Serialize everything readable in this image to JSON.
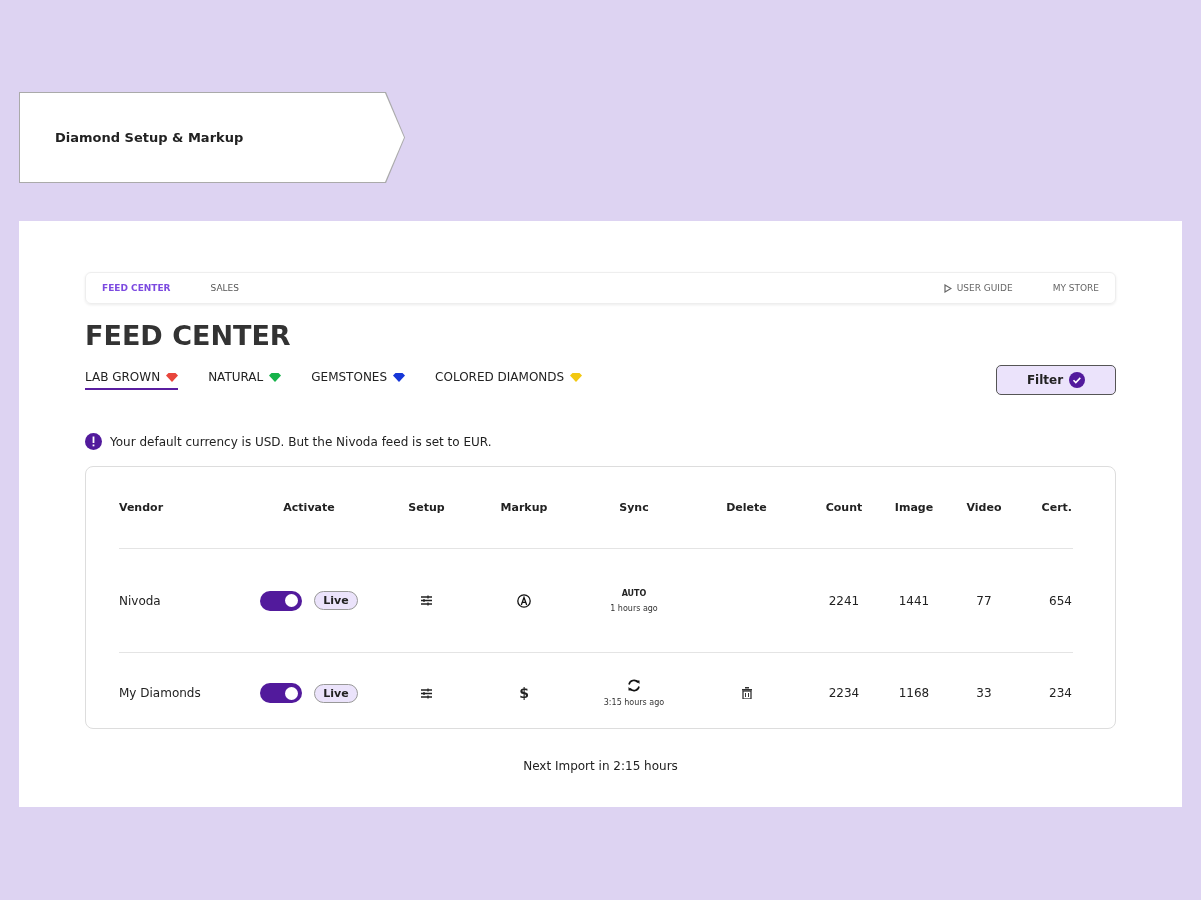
{
  "breadcrumb": {
    "label": "Diamond Setup & Markup"
  },
  "nav": {
    "tabs": [
      {
        "label": "FEED CENTER",
        "selected": true
      },
      {
        "label": "SALES",
        "selected": false
      }
    ],
    "links": [
      {
        "label": "USER GUIDE",
        "kind": "guide"
      },
      {
        "label": "MY STORE",
        "kind": "plain"
      }
    ]
  },
  "page_title": "FEED CENTER",
  "categories": [
    {
      "label": "LAB GROWN",
      "color": "#e8463c",
      "selected": true
    },
    {
      "label": "NATURAL",
      "color": "#16b34a",
      "selected": false
    },
    {
      "label": "GEMSTONES",
      "color": "#1637d8",
      "selected": false
    },
    {
      "label": "COLORED DIAMONDS",
      "color": "#f2c811",
      "selected": false
    }
  ],
  "filter_button": {
    "label": "Filter",
    "applied": true
  },
  "notice": "Your default currency is USD. But the Nivoda feed is set to EUR.",
  "table": {
    "columns": [
      "Vendor",
      "Activate",
      "Setup",
      "Markup",
      "Sync",
      "Delete",
      "Count",
      "Image",
      "Video",
      "Cert."
    ],
    "rows": [
      {
        "vendor": "Nivoda",
        "on": true,
        "status": "Live",
        "markup": {
          "kind": "auto"
        },
        "sync": {
          "kind": "auto",
          "label": "AUTO",
          "time": "1 hours ago"
        },
        "deletable": false,
        "count": "2241",
        "image": "1441",
        "video": "77",
        "cert": "654"
      },
      {
        "vendor": "My Diamonds",
        "on": true,
        "status": "Live",
        "markup": {
          "kind": "price",
          "symbol": "$"
        },
        "sync": {
          "kind": "manual",
          "time": "3:15 hours ago"
        },
        "deletable": true,
        "count": "2234",
        "image": "1168",
        "video": "33",
        "cert": "234"
      }
    ]
  },
  "footer": "Next Import in 2:15 hours"
}
